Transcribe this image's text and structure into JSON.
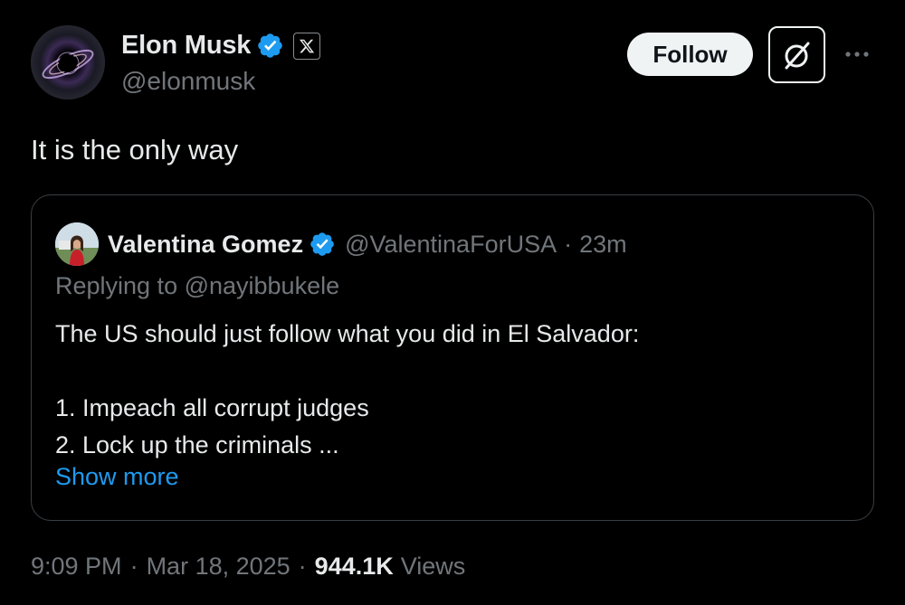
{
  "author": {
    "display_name": "Elon Musk",
    "handle": "@elonmusk",
    "verified_icon": "verified-badge-icon",
    "affiliation_icon": "x-logo-icon",
    "avatar_icon": "black-hole-avatar"
  },
  "actions": {
    "follow_label": "Follow",
    "grok_icon": "grok-icon",
    "more_icon": "more-options-icon"
  },
  "tweet": {
    "text": "It is the only way"
  },
  "quoted_tweet": {
    "display_name": "Valentina Gomez",
    "handle": "@ValentinaForUSA",
    "separator": "·",
    "time_ago": "23m",
    "replying_to": "Replying to @nayibbukele",
    "body_lines": [
      "The US should just follow what you did in El Salvador:",
      "",
      "1. Impeach all corrupt judges",
      "2. Lock up the criminals ..."
    ],
    "show_more": "Show more"
  },
  "meta": {
    "time": "9:09 PM",
    "separator": "·",
    "date": "Mar 18, 2025",
    "views_count": "944.1K",
    "views_label": "Views"
  },
  "colors": {
    "background": "#000000",
    "primary_text": "#e7e9ea",
    "secondary_text": "#71767b",
    "link": "#1d9bf0",
    "verified": "#1d9bf0",
    "border": "#3a3f44"
  }
}
